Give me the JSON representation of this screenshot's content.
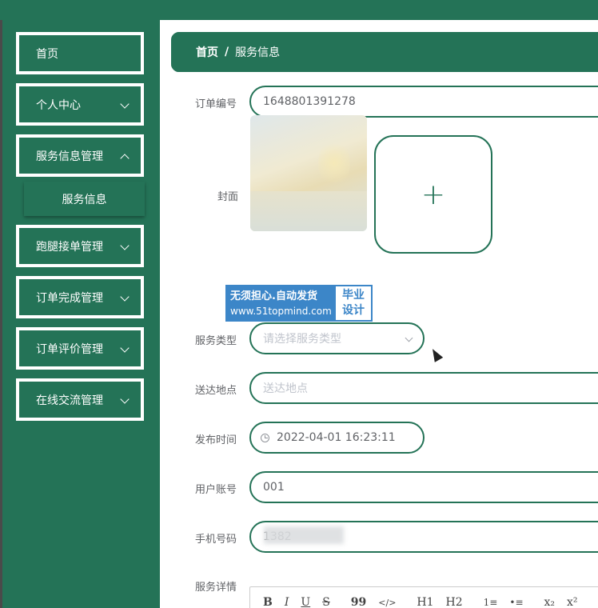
{
  "sidebar": {
    "items": [
      {
        "label": "首页",
        "has_chevron": false
      },
      {
        "label": "个人中心",
        "has_chevron": true
      },
      {
        "label": "服务信息管理",
        "has_chevron": true
      },
      {
        "label": "跑腿接单管理",
        "has_chevron": true
      },
      {
        "label": "订单完成管理",
        "has_chevron": true
      },
      {
        "label": "订单评价管理",
        "has_chevron": true
      },
      {
        "label": "在线交流管理",
        "has_chevron": true
      }
    ],
    "submenu": {
      "label": "服务信息"
    }
  },
  "breadcrumb": {
    "home": "首页",
    "separator": "/",
    "current": "服务信息"
  },
  "form": {
    "order_no": {
      "label": "订单编号",
      "value": "1648801391278"
    },
    "cover": {
      "label": "封面",
      "upload_icon": "+"
    },
    "service_type": {
      "label": "服务类型",
      "placeholder": "请选择服务类型"
    },
    "address": {
      "label": "送达地点",
      "placeholder": "送达地点"
    },
    "publish_time": {
      "label": "发布时间",
      "value": "2022-04-01 16:23:11"
    },
    "user_account": {
      "label": "用户账号",
      "value": "001"
    },
    "phone": {
      "label": "手机号码",
      "value": "1382"
    },
    "detail": {
      "label": "服务详情"
    }
  },
  "watermark": {
    "line1": "无须担心.自动发货",
    "line2": "www.51topmind.com",
    "badge_line1": "毕业",
    "badge_line2": "设计"
  },
  "editor_toolbar": [
    "B",
    "I",
    "U",
    "S",
    "99",
    "</>",
    "H1",
    "H2",
    "1≡",
    "•≡",
    "x₂",
    "x²"
  ],
  "colors": {
    "primary": "#247357",
    "border": "#247357",
    "placeholder": "#c0c4cc",
    "text": "#606266",
    "watermark_blue": "#3c86c8"
  }
}
